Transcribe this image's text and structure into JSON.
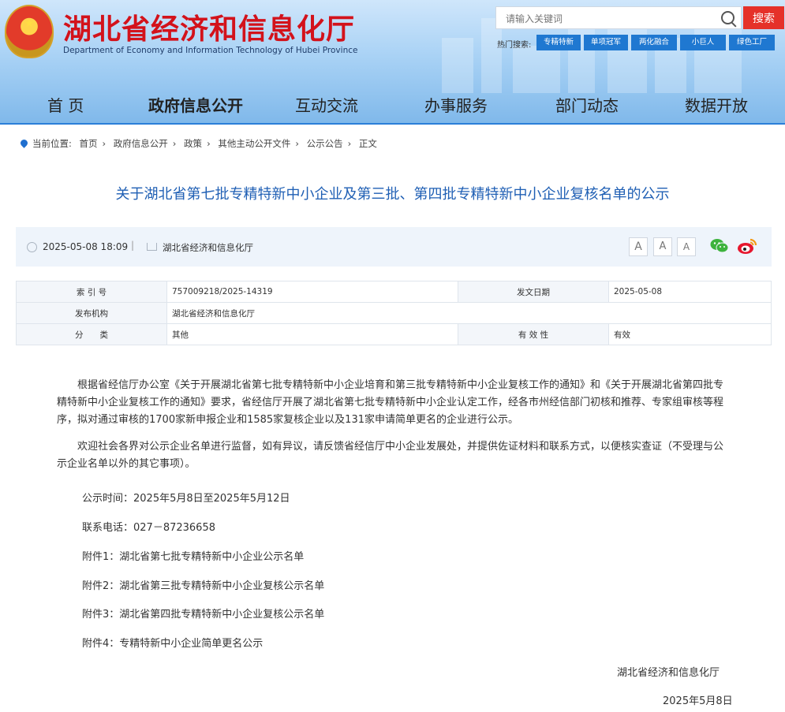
{
  "site": {
    "title": "湖北省经济和信息化厅",
    "subtitle": "Department of Economy and Information Technology of Hubei Province"
  },
  "search": {
    "placeholder": "请输入关键词",
    "button": "搜索",
    "hot_label": "热门搜索:",
    "hot_tags": [
      "专精特新",
      "单项冠军",
      "两化融合",
      "小巨人",
      "绿色工厂"
    ]
  },
  "nav": [
    "首 页",
    "政府信息公开",
    "互动交流",
    "办事服务",
    "部门动态",
    "数据开放"
  ],
  "breadcrumb": {
    "label": "当前位置:",
    "items": [
      "首页",
      "政府信息公开",
      "政策",
      "其他主动公开文件",
      "公示公告",
      "正文"
    ],
    "sep": "›"
  },
  "article": {
    "title": "关于湖北省第七批专精特新中小企业及第三批、第四批专精特新中小企业复核名单的公示",
    "date": "2025-05-08 18:09",
    "source": "湖北省经济和信息化厅",
    "font_sizes": [
      "A",
      "A",
      "A"
    ],
    "paragraphs": [
      "根据省经信厅办公室《关于开展湖北省第七批专精特新中小企业培育和第三批专精特新中小企业复核工作的通知》和《关于开展湖北省第四批专精特新中小企业复核工作的通知》要求，省经信厅开展了湖北省第七批专精特新中小企业认定工作，经各市州经信部门初核和推荐、专家组审核等程序，拟对通过审核的1700家新申报企业和1585家复核企业以及131家申请简单更名的企业进行公示。",
      "欢迎社会各界对公示企业名单进行监督，如有异议，请反馈省经信厅中小企业发展处，并提供佐证材料和联系方式，以便核实查证（不受理与公示企业名单以外的其它事项）。"
    ],
    "lines": [
      "公示时间：2025年5月8日至2025年5月12日",
      "联系电话：027－87236658",
      "附件1：湖北省第七批专精特新中小企业公示名单",
      "附件2：湖北省第三批专精特新中小企业复核公示名单",
      "附件3：湖北省第四批专精特新中小企业复核公示名单",
      "附件4：专精特新中小企业简单更名公示"
    ],
    "signature": "湖北省经济和信息化厅",
    "sign_date": "2025年5月8日"
  },
  "info_table": {
    "index_label": "索 引 号",
    "index_value": "757009218/2025-14319",
    "date_label": "发文日期",
    "date_value": "2025-05-08",
    "org_label": "发布机构",
    "org_value": "湖北省经济和信息化厅",
    "cat_label": "分　　类",
    "cat_value": "其他",
    "valid_label": "有 效 性",
    "valid_value": "有效"
  }
}
